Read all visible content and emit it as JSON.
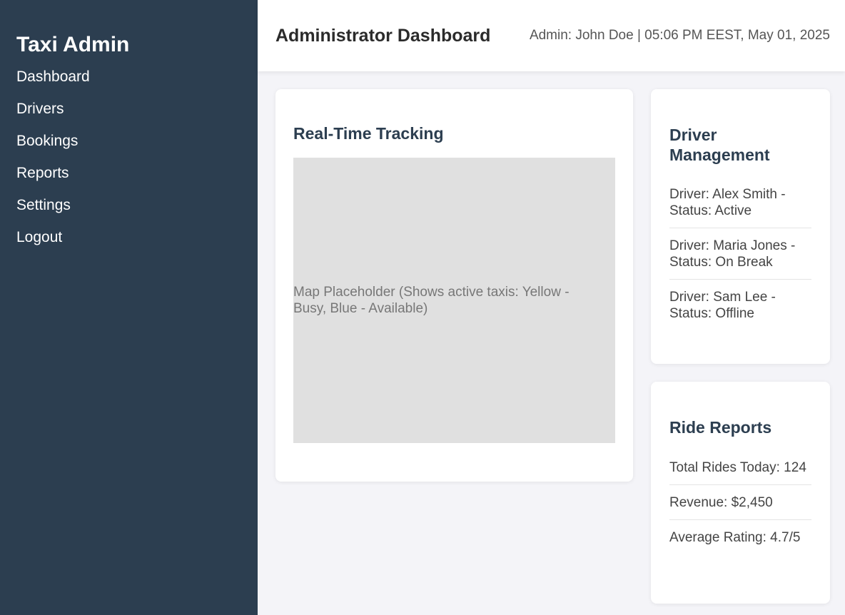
{
  "sidebar": {
    "brand": "Taxi Admin",
    "items": [
      {
        "label": "Dashboard"
      },
      {
        "label": "Drivers"
      },
      {
        "label": "Bookings"
      },
      {
        "label": "Reports"
      },
      {
        "label": "Settings"
      },
      {
        "label": "Logout"
      }
    ]
  },
  "header": {
    "title": "Administrator Dashboard",
    "admin_info": "Admin: John Doe | 05:06 PM EEST, May 01, 2025"
  },
  "tracking": {
    "title": "Real-Time Tracking",
    "map_placeholder": "Map Placeholder (Shows active taxis: Yellow - Busy, Blue - Available)"
  },
  "drivers": {
    "title": "Driver Management",
    "items": [
      {
        "text": "Driver: Alex Smith - Status: Active"
      },
      {
        "text": "Driver: Maria Jones - Status: On Break"
      },
      {
        "text": "Driver: Sam Lee - Status: Offline"
      }
    ]
  },
  "reports": {
    "title": "Ride Reports",
    "items": [
      {
        "text": "Total Rides Today: 124"
      },
      {
        "text": "Revenue: $2,450"
      },
      {
        "text": "Average Rating: 4.7/5"
      }
    ]
  },
  "colors": {
    "sidebar_bg": "#2c3e50",
    "page_bg": "#f4f4f8",
    "map_bg": "#e0e0e0"
  }
}
